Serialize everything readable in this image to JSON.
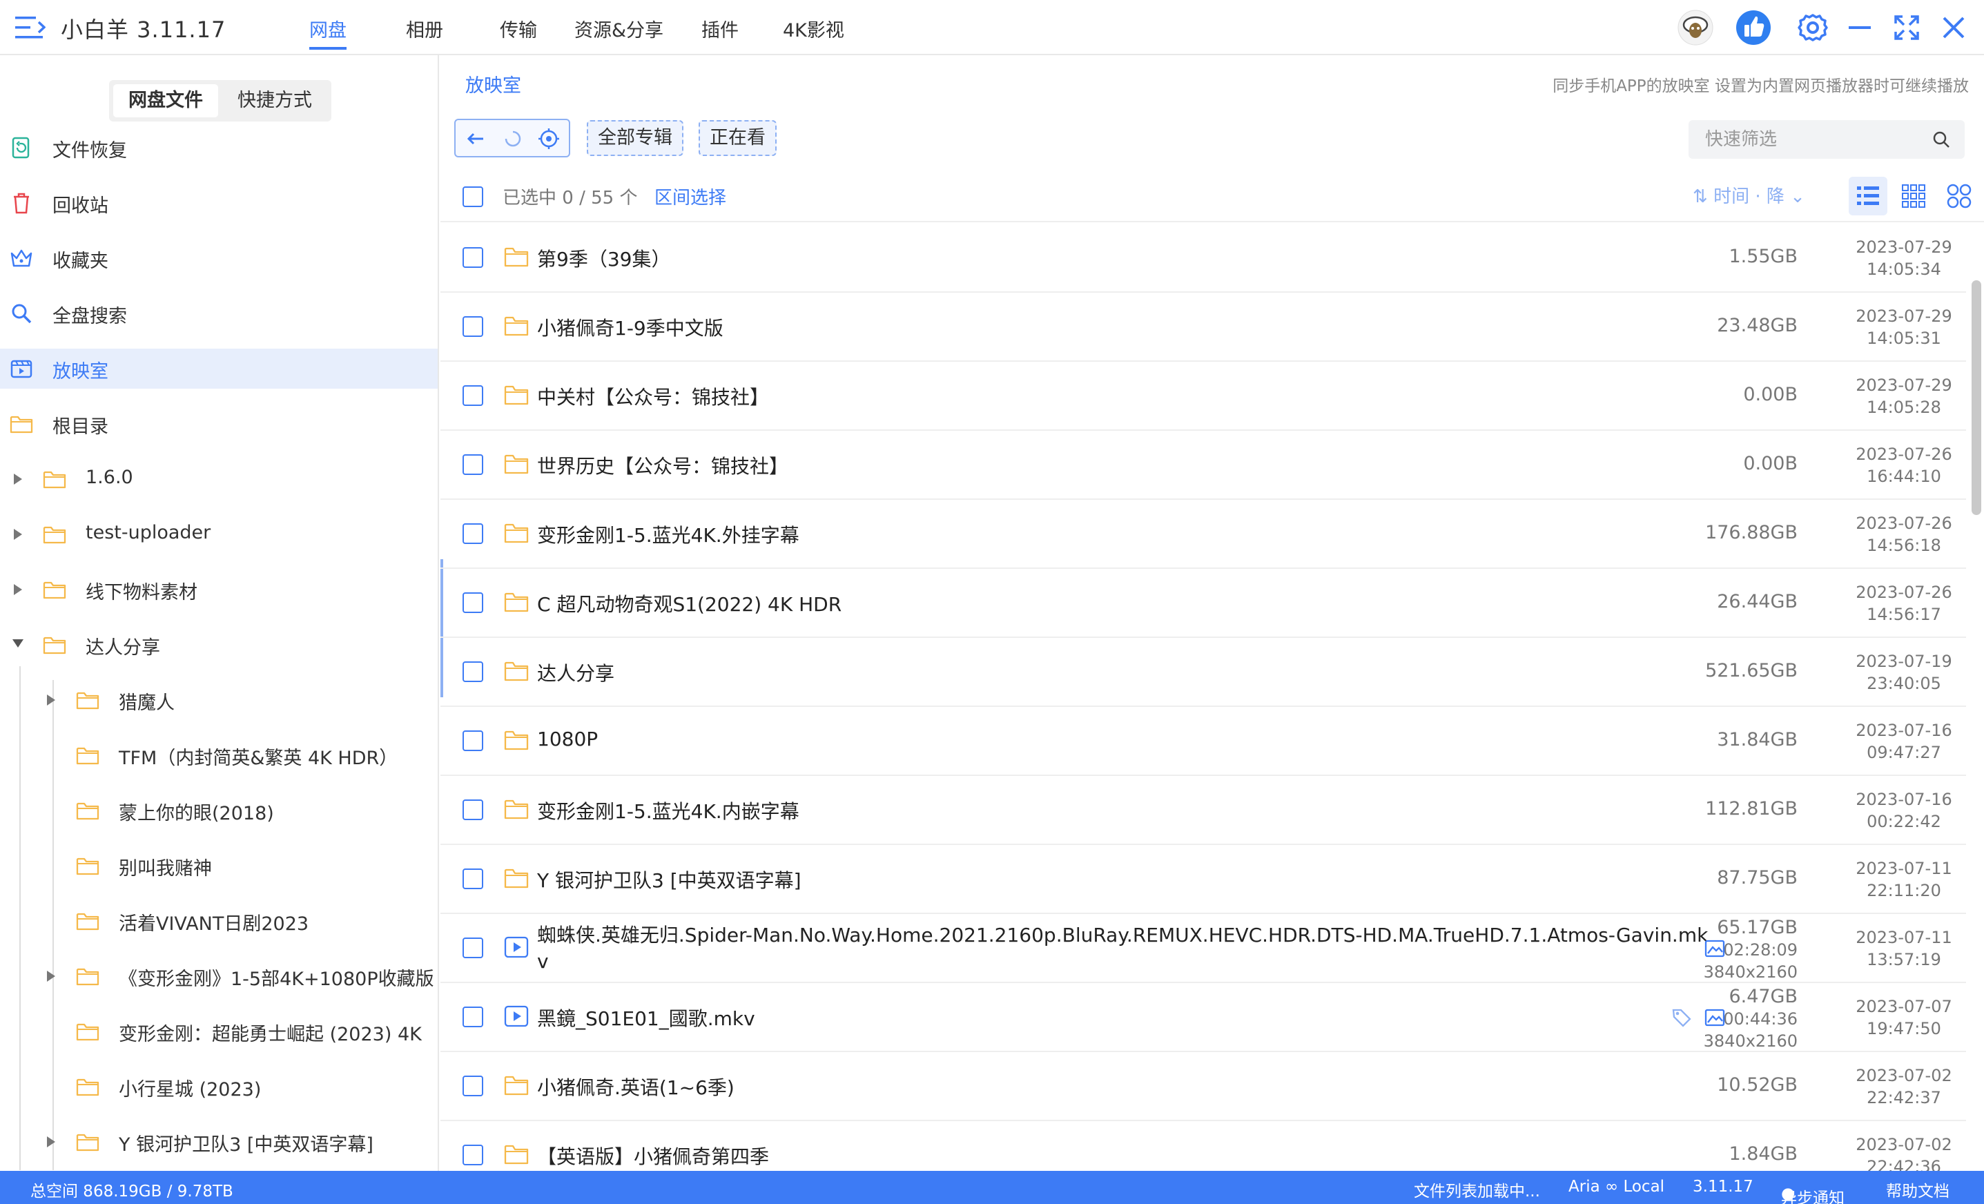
{
  "app": {
    "title": "小白羊 3.11.17"
  },
  "nav": {
    "tabs": [
      "网盘",
      "相册",
      "传输",
      "资源&分享",
      "插件",
      "4K影视"
    ],
    "active": "网盘"
  },
  "sidebar": {
    "tabs": [
      "网盘文件",
      "快捷方式"
    ],
    "items": [
      "文件恢复",
      "回收站",
      "收藏夹",
      "全盘搜索",
      "放映室",
      "根目录"
    ],
    "tree": [
      "1.6.0",
      "test-uploader",
      "线下物料素材",
      "达人分享"
    ],
    "subtree": [
      "猎魔人",
      "TFM（内封简英&繁英 4K HDR）",
      "蒙上你的眼(2018)",
      "别叫我赌神",
      "活着VIVANT日剧2023",
      "《变形金刚》1-5部4K+1080P收藏版",
      "变形金刚：超能勇士崛起 (2023) 4K",
      "小行星城 (2023)",
      "Y 银河护卫队3 [中英双语字幕]"
    ]
  },
  "main": {
    "breadcrumb": "放映室",
    "sync_hint": "同步手机APP的放映室 设置为内置网页播放器时可继续播放",
    "tag_all": "全部专辑",
    "tag_watching": "正在看",
    "search_placeholder": "快速筛选",
    "selection": "已选中 0 / 55 个",
    "range_select": "区间选择",
    "sort": "时间 · 降"
  },
  "files": [
    {
      "name": "第9季（39集）",
      "size": "1.55GB",
      "date": "2023-07-29",
      "time": "14:05:34",
      "type": "folder"
    },
    {
      "name": "小猪佩奇1-9季中文版",
      "size": "23.48GB",
      "date": "2023-07-29",
      "time": "14:05:31",
      "type": "folder"
    },
    {
      "name": "中关村【公众号：锦技社】",
      "size": "0.00B",
      "date": "2023-07-29",
      "time": "14:05:28",
      "type": "folder"
    },
    {
      "name": "世界历史【公众号：锦技社】",
      "size": "0.00B",
      "date": "2023-07-26",
      "time": "16:44:10",
      "type": "folder"
    },
    {
      "name": "变形金刚1-5.蓝光4K.外挂字幕",
      "size": "176.88GB",
      "date": "2023-07-26",
      "time": "14:56:18",
      "type": "folder"
    },
    {
      "name": "C 超凡动物奇观S1(2022) 4K HDR",
      "size": "26.44GB",
      "date": "2023-07-26",
      "time": "14:56:17",
      "type": "folder"
    },
    {
      "name": "达人分享",
      "size": "521.65GB",
      "date": "2023-07-19",
      "time": "23:40:05",
      "type": "folder"
    },
    {
      "name": "1080P",
      "size": "31.84GB",
      "date": "2023-07-16",
      "time": "09:47:27",
      "type": "folder"
    },
    {
      "name": "变形金刚1-5.蓝光4K.内嵌字幕",
      "size": "112.81GB",
      "date": "2023-07-16",
      "time": "00:22:42",
      "type": "folder"
    },
    {
      "name": "Y 银河护卫队3 [中英双语字幕]",
      "size": "87.75GB",
      "date": "2023-07-11",
      "time": "22:11:20",
      "type": "folder"
    },
    {
      "name": "蜘蛛侠.英雄无归.Spider-Man.No.Way.Home.2021.2160p.BluRay.REMUX.HEVC.HDR.DTS-HD.MA.TrueHD.7.1.Atmos-Gavin.mkv",
      "size": "65.17GB",
      "duration": "02:28:09",
      "resolution": "3840x2160",
      "date": "2023-07-11",
      "time": "13:57:19",
      "type": "video"
    },
    {
      "name": "黑鏡_S01E01_國歌.mkv",
      "size": "6.47GB",
      "duration": "00:44:36",
      "resolution": "3840x2160",
      "date": "2023-07-07",
      "time": "19:47:50",
      "type": "video"
    },
    {
      "name": "小猪佩奇.英语(1~6季)",
      "size": "10.52GB",
      "date": "2023-07-02",
      "time": "22:42:37",
      "type": "folder"
    },
    {
      "name": "【英语版】小猪佩奇第四季",
      "size": "1.84GB",
      "date": "2023-07-02",
      "time": "22:42:36",
      "type": "folder"
    }
  ],
  "status": {
    "space": "总空间 868.19GB / 9.78TB",
    "loading": "文件列表加载中...",
    "aria": "Aria ∞ Local",
    "version": "3.11.17",
    "notify": "异步通知",
    "help": "帮助文档"
  },
  "colors": {
    "accent": "#3d7bf5",
    "folder": "#f5b94a",
    "status_bar": "#3d7bf5"
  },
  "icons": [
    "menu-icon",
    "sheep-avatar-icon",
    "thumbs-up-icon",
    "gear-icon",
    "minimize-icon",
    "maximize-icon",
    "close-icon",
    "folder-icon",
    "video-file-icon"
  ]
}
